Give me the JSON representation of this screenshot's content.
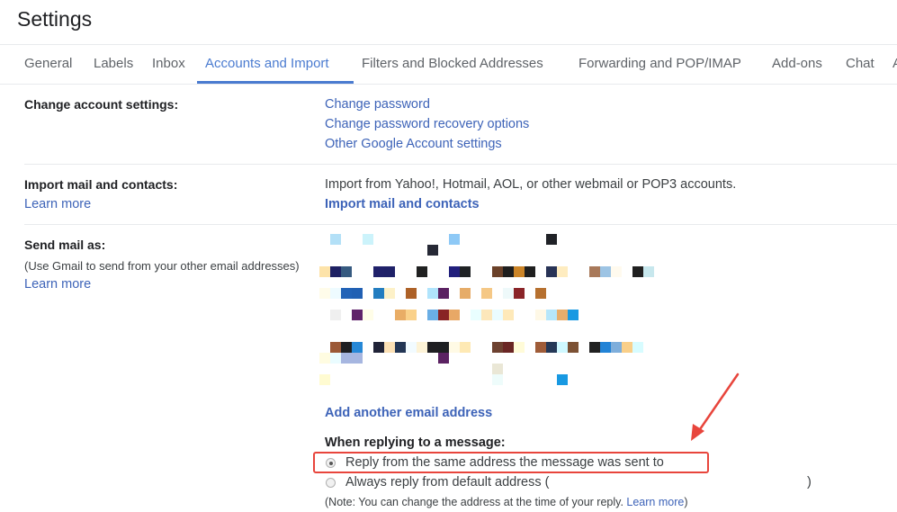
{
  "header": {
    "title": "Settings"
  },
  "tabs": [
    {
      "label": "General",
      "active": false
    },
    {
      "label": "Labels",
      "active": false
    },
    {
      "label": "Inbox",
      "active": false
    },
    {
      "label": "Accounts and Import",
      "active": true
    },
    {
      "label": "Filters and Blocked Addresses",
      "active": false
    },
    {
      "label": "Forwarding and POP/IMAP",
      "active": false
    },
    {
      "label": "Add-ons",
      "active": false
    },
    {
      "label": "Chat",
      "active": false
    },
    {
      "label": "A",
      "active": false
    }
  ],
  "sections": {
    "change_account": {
      "label": "Change account settings:",
      "links": [
        "Change password",
        "Change password recovery options",
        "Other Google Account settings"
      ]
    },
    "import": {
      "label": "Import mail and contacts:",
      "learn_more": "Learn more",
      "description": "Import from Yahoo!, Hotmail, AOL, or other webmail or POP3 accounts.",
      "action": "Import mail and contacts"
    },
    "send_mail_as": {
      "label": "Send mail as:",
      "sublabel": "(Use Gmail to send from your other email addresses)",
      "learn_more": "Learn more",
      "redacted_note": "pixelated / redacted email address list",
      "add_address": "Add another email address",
      "reply_heading": "When replying to a message:",
      "reply_options": [
        {
          "label": "Reply from the same address the message was sent to",
          "selected": true
        },
        {
          "label": "Always reply from default address (",
          "suffix": ")",
          "selected": false
        }
      ],
      "note_text": "(Note: You can change the address at the time of your reply. ",
      "note_link": "Learn more",
      "note_close": ")"
    }
  },
  "annotation": {
    "color": "#e8453c",
    "target": "Reply from the same address the message was sent to"
  },
  "colors": {
    "accent": "#4a7bd0",
    "link": "#3d63b8",
    "annotation": "#e8453c"
  },
  "mosaic": [
    [
      "-",
      "#b3e0f7",
      "-",
      "-",
      "#ccf3fb",
      "-",
      "-",
      "-",
      "-",
      "-",
      "-",
      "-",
      "#8ec9f6",
      "-",
      "-",
      "-",
      "-",
      "-",
      "-",
      "-",
      "-",
      "#202227",
      "-",
      "-",
      "-",
      "-",
      "-",
      "-",
      "-",
      "-",
      "-",
      "-",
      "-"
    ],
    [
      "-",
      "-",
      "-",
      "-",
      "-",
      "-",
      "-",
      "-",
      "-",
      "-",
      "#262835",
      "-",
      "-",
      "-",
      "-",
      "-",
      "-",
      "-",
      "-",
      "-",
      "-",
      "-",
      "-",
      "-",
      "-",
      "-",
      "-",
      "-",
      "-",
      "-",
      "-",
      "-",
      "-"
    ],
    null,
    [
      "#fde3a9",
      "#1e2163",
      "#365a80",
      "-",
      "-",
      "#20216a",
      "#1f2168",
      "-",
      "-",
      "#202121",
      "-",
      "-",
      "#211f7c",
      "#1f2224",
      "-",
      "-",
      "#6b4129",
      "#1f1f1f",
      "#cc8528",
      "#1f1f1f",
      "-",
      "#283356",
      "#feecc0",
      "-",
      "-",
      "#a8795a",
      "#9dc4e4",
      "#fffaee",
      "-",
      "#202020",
      "#c7e7ed",
      "-",
      "-"
    ],
    null,
    [
      "#fffcea",
      "#eefbff",
      "#2263b7",
      "#2160b3",
      "-",
      "#237dc0",
      "#fdf1c8",
      "-",
      "#ad6127",
      "-",
      "#b0e4fc",
      "#5b2162",
      "-",
      "#e6ac68",
      "-",
      "#f5c886",
      "-",
      "#eef9fa",
      "#8a2428",
      "-",
      "#b6702f",
      "-",
      "-",
      "-",
      "-",
      "-",
      "-",
      "-",
      "-",
      "-",
      "-",
      "-",
      "-"
    ],
    null,
    [
      "-",
      "#efefef",
      "-",
      "#60226a",
      "#fffde8",
      "-",
      "-",
      "#e9ad66",
      "#fad18a",
      "-",
      "#6aaee5",
      "#892324",
      "#e8a866",
      "-",
      "#e9feff",
      "#fce7ba",
      "#eafcff",
      "#fee9b9",
      "-",
      "-",
      "#fef8e6",
      "#b6e6fa",
      "#e7ad6c",
      "#1899e2",
      "-",
      "-",
      "-",
      "-",
      "-",
      "-",
      "-",
      "-",
      "-"
    ],
    null,
    null,
    [
      "-",
      "#9b5937",
      "#1e1f22",
      "#2688d7",
      "-",
      "#202337",
      "#fbe0b5",
      "#233655",
      "#f2fbff",
      "#fdf3d7",
      "#1f1f22",
      "#1e1f22",
      "#fffae5",
      "#fee9b4",
      "-",
      "-",
      "#6d4130",
      "#6a2624",
      "#fffbd8",
      "-",
      "#9f5c38",
      "#253857",
      "#cff8ff",
      "#7c5134",
      "-",
      "#202121",
      "#2283d6",
      "#7eaedb",
      "#f9cf89",
      "#d7fcff",
      "-",
      "-",
      "-"
    ],
    [
      "#fffce1",
      "#eafcff",
      "#a6b6e0",
      "#a6b6e0",
      "-",
      "-",
      "-",
      "-",
      "-",
      "-",
      "-",
      "#5b2262",
      "-",
      "-",
      "-",
      "-",
      "-",
      "-",
      "-",
      "-",
      "-",
      "-",
      "-",
      "-",
      "-",
      "-",
      "-",
      "-",
      "-",
      "-",
      "-",
      "-",
      "-"
    ],
    [
      "-",
      "-",
      "-",
      "-",
      "-",
      "-",
      "-",
      "-",
      "-",
      "-",
      "-",
      "-",
      "-",
      "-",
      "-",
      "-",
      "#eae7d6",
      "-",
      "-",
      "-",
      "-",
      "-",
      "-",
      "-",
      "-",
      "-",
      "-",
      "-",
      "-",
      "-",
      "-",
      "-",
      "-"
    ],
    [
      "#fffbd1",
      "-",
      "-",
      "-",
      "-",
      "-",
      "-",
      "-",
      "-",
      "-",
      "-",
      "-",
      "-",
      "-",
      "-",
      "-",
      "#eefcfb",
      "-",
      "-",
      "-",
      "-",
      "-",
      "#1899e2",
      "-",
      "-",
      "-",
      "-",
      "-",
      "-",
      "-",
      "-",
      "-",
      "-"
    ]
  ]
}
